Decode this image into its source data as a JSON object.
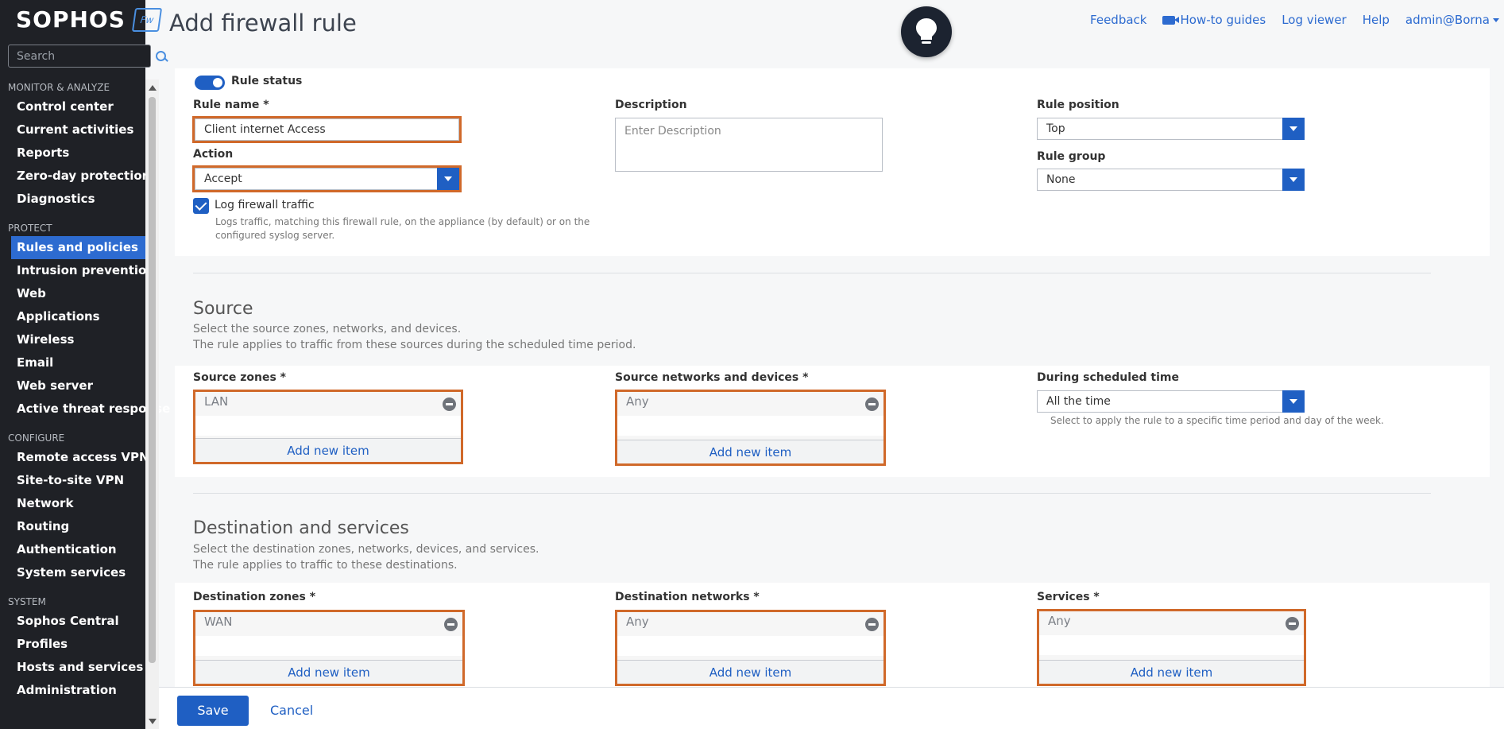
{
  "brand": {
    "logo_text": "SOPHOS",
    "badge_text": "Fw"
  },
  "sidebar": {
    "search_placeholder": "Search",
    "sections": [
      {
        "title": "MONITOR & ANALYZE",
        "items": [
          "Control center",
          "Current activities",
          "Reports",
          "Zero-day protection",
          "Diagnostics"
        ]
      },
      {
        "title": "PROTECT",
        "items": [
          "Rules and policies",
          "Intrusion prevention",
          "Web",
          "Applications",
          "Wireless",
          "Email",
          "Web server",
          "Active threat response"
        ]
      },
      {
        "title": "CONFIGURE",
        "items": [
          "Remote access VPN",
          "Site-to-site VPN",
          "Network",
          "Routing",
          "Authentication",
          "System services"
        ]
      },
      {
        "title": "SYSTEM",
        "items": [
          "Sophos Central",
          "Profiles",
          "Hosts and services",
          "Administration"
        ]
      }
    ],
    "active_item": "Rules and policies"
  },
  "header": {
    "title": "Add firewall rule",
    "links": {
      "feedback": "Feedback",
      "howto": "How-to guides",
      "logviewer": "Log viewer",
      "help": "Help",
      "user": "admin@Borna"
    }
  },
  "rule": {
    "status_label": "Rule status",
    "name_label": "Rule name *",
    "name_value": "Client internet Access",
    "action_label": "Action",
    "action_value": "Accept",
    "log_label": "Log firewall traffic",
    "log_hint_1": "Logs traffic, matching this firewall rule, on the appliance (by default) or on the",
    "log_hint_2": "configured syslog server.",
    "description_label": "Description",
    "description_placeholder": "Enter Description",
    "position_label": "Rule position",
    "position_value": "Top",
    "group_label": "Rule group",
    "group_value": "None"
  },
  "source": {
    "title": "Source",
    "desc_1": "Select the source zones, networks, and devices.",
    "desc_2": "The rule applies to traffic from these sources during the scheduled time period.",
    "zones_label": "Source zones *",
    "zones_value": "LAN",
    "networks_label": "Source networks and devices *",
    "networks_value": "Any",
    "schedule_label": "During scheduled time",
    "schedule_value": "All the time",
    "schedule_hint": "Select to apply the rule to a specific time period and day of the week.",
    "add_label": "Add new item"
  },
  "destination": {
    "title": "Destination and services",
    "desc_1": "Select the destination zones, networks, devices, and services.",
    "desc_2": "The rule applies to traffic to these destinations.",
    "zones_label": "Destination zones *",
    "zones_value": "WAN",
    "networks_label": "Destination networks *",
    "networks_value": "Any",
    "services_label": "Services *",
    "services_value": "Any",
    "add_label": "Add new item"
  },
  "footer": {
    "save_label": "Save",
    "cancel_label": "Cancel"
  },
  "colors": {
    "accent": "#1f5fc3",
    "highlight": "#d0692a",
    "sidebar_bg": "#1f2126"
  }
}
